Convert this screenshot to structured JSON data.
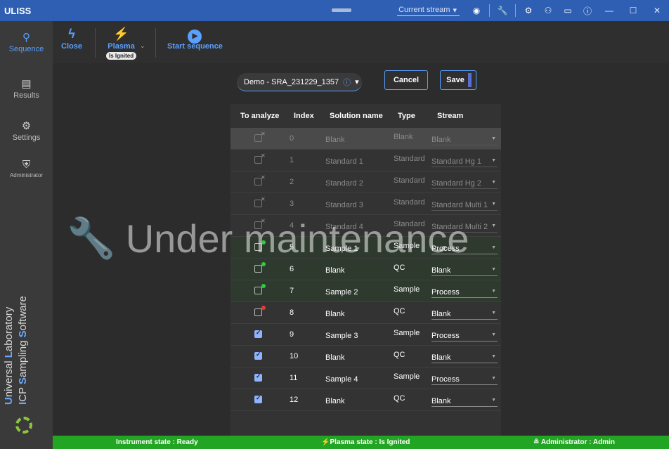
{
  "app": {
    "title": "ULISS",
    "stream_select_label": "Current stream",
    "stream_select_arrow": "▾",
    "icons": {
      "eye_off": "◉",
      "maintenance": "🔧",
      "settings": "⚙",
      "users": "⚇",
      "monitor": "▭",
      "info": "ⓘ",
      "minimize": "—",
      "maximize": "☐",
      "close": "✕"
    },
    "colors": {
      "titlebar": "#2f5fb3",
      "accent": "#5aa0ff",
      "status": "#22a522"
    }
  },
  "sidebar": {
    "items": [
      {
        "label": "Sequence",
        "icon": "⚲"
      },
      {
        "label": "Results",
        "icon": "▤"
      },
      {
        "label": "Settings",
        "icon": "⚙"
      },
      {
        "label": "Administrator",
        "icon": "⛨"
      }
    ],
    "brand_line1": [
      "U",
      "niversal ",
      "L",
      "aboratory"
    ],
    "brand_line2": [
      "I",
      "CP ",
      "S",
      "ampling ",
      "S",
      "oftware"
    ]
  },
  "toolbar": {
    "close_label": "Close",
    "close_icon": "ϟ",
    "plasma_label": "Plasma",
    "plasma_icon": "⚡",
    "plasma_badge": "Is Ignited",
    "plasma_dropdown": "⌄",
    "start_label": "Start sequence",
    "start_icon": "▶"
  },
  "sequence": {
    "selected": "Demo - SRA_231229_1357",
    "info_icon": "ⓘ",
    "dropdown": "▾",
    "cancel_label": "Cancel",
    "save_label": "Save"
  },
  "table": {
    "headers": [
      "To analyze",
      "Index",
      "Solution name",
      "Type",
      "Stream"
    ],
    "rows": [
      {
        "checked": false,
        "disabled": true,
        "index": "0",
        "name": "Blank",
        "type": "Blank",
        "stream": "Blank",
        "dot": ""
      },
      {
        "checked": false,
        "disabled": true,
        "index": "1",
        "name": "Standard 1",
        "type": "Standard",
        "stream": "Standard Hg 1",
        "dot": ""
      },
      {
        "checked": false,
        "disabled": true,
        "index": "2",
        "name": "Standard 2",
        "type": "Standard",
        "stream": "Standard Hg 2",
        "dot": ""
      },
      {
        "checked": false,
        "disabled": true,
        "index": "3",
        "name": "Standard 3",
        "type": "Standard",
        "stream": "Standard Multi 1",
        "dot": ""
      },
      {
        "checked": false,
        "disabled": true,
        "index": "4",
        "name": "Standard 4",
        "type": "Standard",
        "stream": "Standard Multi 2",
        "dot": ""
      },
      {
        "checked": false,
        "disabled": false,
        "index": "5",
        "name": "Sample 1",
        "type": "Sample",
        "stream": "Process",
        "dot": "#2ecc40",
        "green": true
      },
      {
        "checked": false,
        "disabled": false,
        "index": "6",
        "name": "Blank",
        "type": "QC",
        "stream": "Blank",
        "dot": "#2ecc40",
        "green": true
      },
      {
        "checked": false,
        "disabled": false,
        "index": "7",
        "name": "Sample 2",
        "type": "Sample",
        "stream": "Process",
        "dot": "#2ecc40",
        "green": true
      },
      {
        "checked": false,
        "disabled": false,
        "index": "8",
        "name": "Blank",
        "type": "QC",
        "stream": "Blank",
        "dot": "#e53935"
      },
      {
        "checked": true,
        "disabled": false,
        "index": "9",
        "name": "Sample 3",
        "type": "Sample",
        "stream": "Process",
        "dot": ""
      },
      {
        "checked": true,
        "disabled": false,
        "index": "10",
        "name": "Blank",
        "type": "QC",
        "stream": "Blank",
        "dot": ""
      },
      {
        "checked": true,
        "disabled": false,
        "index": "11",
        "name": "Sample 4",
        "type": "Sample",
        "stream": "Process",
        "dot": ""
      },
      {
        "checked": true,
        "disabled": false,
        "index": "12",
        "name": "Blank",
        "type": "QC",
        "stream": "Blank",
        "dot": ""
      }
    ]
  },
  "watermark": {
    "text": "Under maintenance",
    "icon": "🔧"
  },
  "status": {
    "instrument": "Instrument state : Ready",
    "plasma": "Plasma state : Is Ignited",
    "plasma_icon": "⚡",
    "user": "Administrator : Admin",
    "user_icon": "≗"
  }
}
